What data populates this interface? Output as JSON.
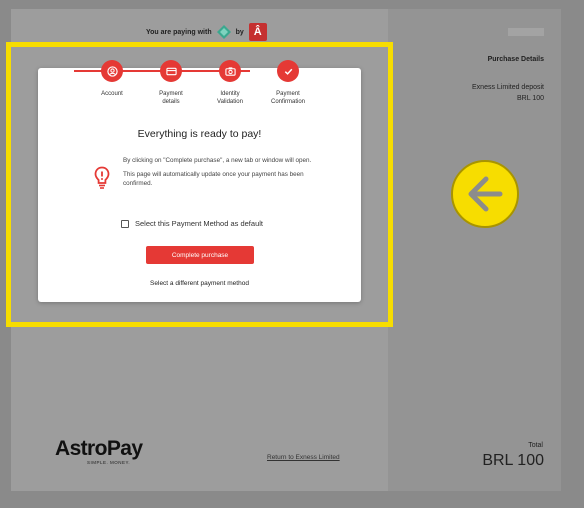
{
  "header": {
    "paying_with": "You are paying with",
    "by": "by",
    "brand_letter": "Â"
  },
  "steps": [
    {
      "label": "Account",
      "icon": "account-icon"
    },
    {
      "label": "Payment\ndetails",
      "icon": "card-icon"
    },
    {
      "label": "Identity\nValidation",
      "icon": "camera-icon"
    },
    {
      "label": "Payment\nConfirmation",
      "icon": "check-icon"
    }
  ],
  "main": {
    "title": "Everything is ready to pay!",
    "info_1": "By clicking on \"Complete purchase\", a new tab or window will open.",
    "info_2": "This page will automatically update once your payment has been confirmed.",
    "checkbox_label": "Select this Payment Method as default",
    "checkbox_checked": false,
    "complete_button": "Complete purchase",
    "different_method": "Select a different payment method"
  },
  "footer": {
    "logo_main": "AstroPay",
    "logo_sub": "SIMPLE. MONEY.",
    "return_link": "Return to Exness Limited"
  },
  "sidebar": {
    "purchase_details": "Purchase Details",
    "deposit_name": "Exness Limited deposit",
    "deposit_amount": "BRL 100",
    "total_label": "Total",
    "total_value": "BRL 100"
  },
  "colors": {
    "accent": "#e53935",
    "highlight": "#f7dd00"
  }
}
